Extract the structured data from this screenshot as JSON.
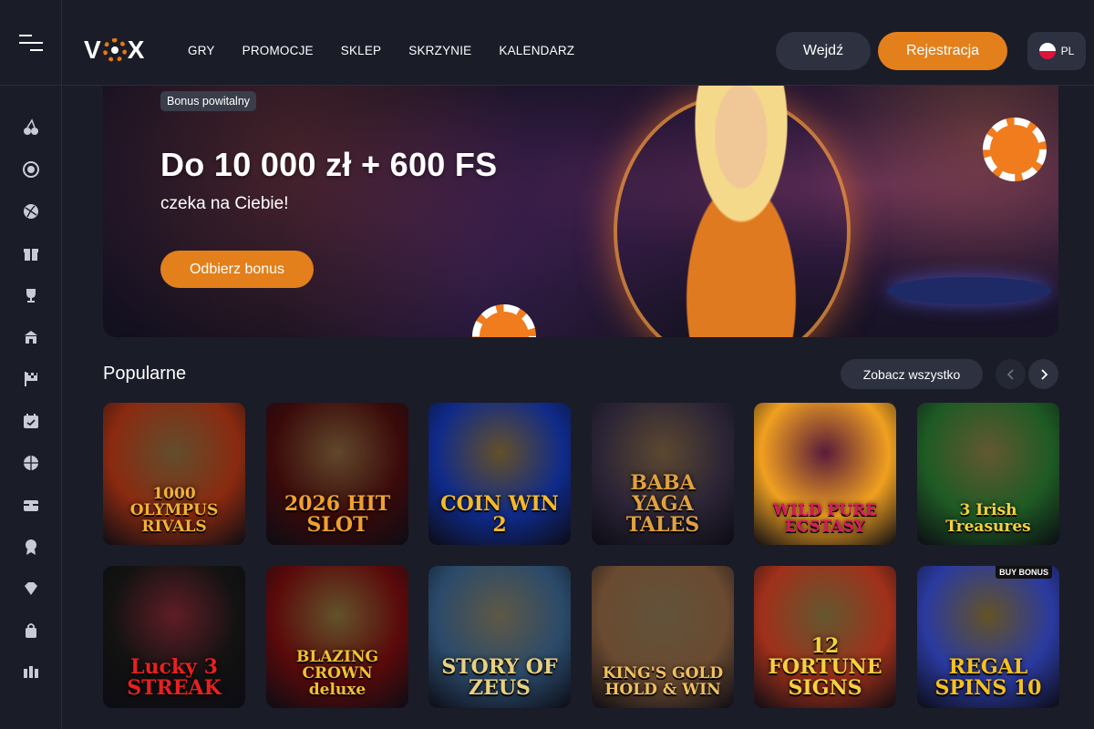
{
  "header": {
    "logo_text": "VOX",
    "nav": [
      "GRY",
      "PROMOCJE",
      "SKLEP",
      "SKRZYNIE",
      "KALENDARZ"
    ],
    "login_label": "Wejdź",
    "register_label": "Rejestracja",
    "language": "PL"
  },
  "sidebar": {
    "icons": [
      "cherries-icon",
      "roulette-icon",
      "sports-ball-icon",
      "gift-icon",
      "trophy-icon",
      "shop-icon",
      "racing-flag-icon",
      "calendar-icon",
      "basketball-icon",
      "chest-icon",
      "award-icon",
      "diamond-icon",
      "bag-icon",
      "columns-icon"
    ]
  },
  "banner": {
    "badge": "Bonus powitalny",
    "title": "Do 10 000 zł + 600 FS",
    "subtitle": "czeka na Ciebie!",
    "cta": "Odbierz bonus"
  },
  "popular": {
    "title": "Popularne",
    "see_all": "Zobacz wszystko",
    "games": [
      {
        "name": "1000 OLYMPUS RIVALS",
        "bg": "#8a2a10",
        "accent": "#f2b136"
      },
      {
        "name": "2026 HIT SLOT",
        "bg": "#3a0a0a",
        "accent": "#f0a030"
      },
      {
        "name": "COIN WIN 2",
        "bg": "#0f2a8a",
        "accent": "#f5b82a"
      },
      {
        "name": "BABA YAGA TALES",
        "bg": "#2b2436",
        "accent": "#e0a040"
      },
      {
        "name": "WILD PURE ECSTASY",
        "bg": "#f0a020",
        "accent": "#d81a60"
      },
      {
        "name": "3 Irish Treasures",
        "bg": "#1e5a24",
        "accent": "#f5d040"
      },
      {
        "name": "Lucky 3 STREAK",
        "bg": "#121212",
        "accent": "#e82020"
      },
      {
        "name": "BLAZING CROWN deluxe",
        "bg": "#5a0a0a",
        "accent": "#f5c030"
      },
      {
        "name": "STORY OF ZEUS",
        "bg": "#2a4a6a",
        "accent": "#e8d080"
      },
      {
        "name": "KING'S GOLD HOLD & WIN",
        "bg": "#6a4a30",
        "accent": "#f0c060"
      },
      {
        "name": "12 FORTUNE SIGNS",
        "bg": "#a0301a",
        "accent": "#f5d040"
      },
      {
        "name": "REGAL SPINS 10",
        "bg": "#2a3aa0",
        "accent": "#f5c020"
      }
    ],
    "buy_bonus_label": "BUY BONUS"
  }
}
